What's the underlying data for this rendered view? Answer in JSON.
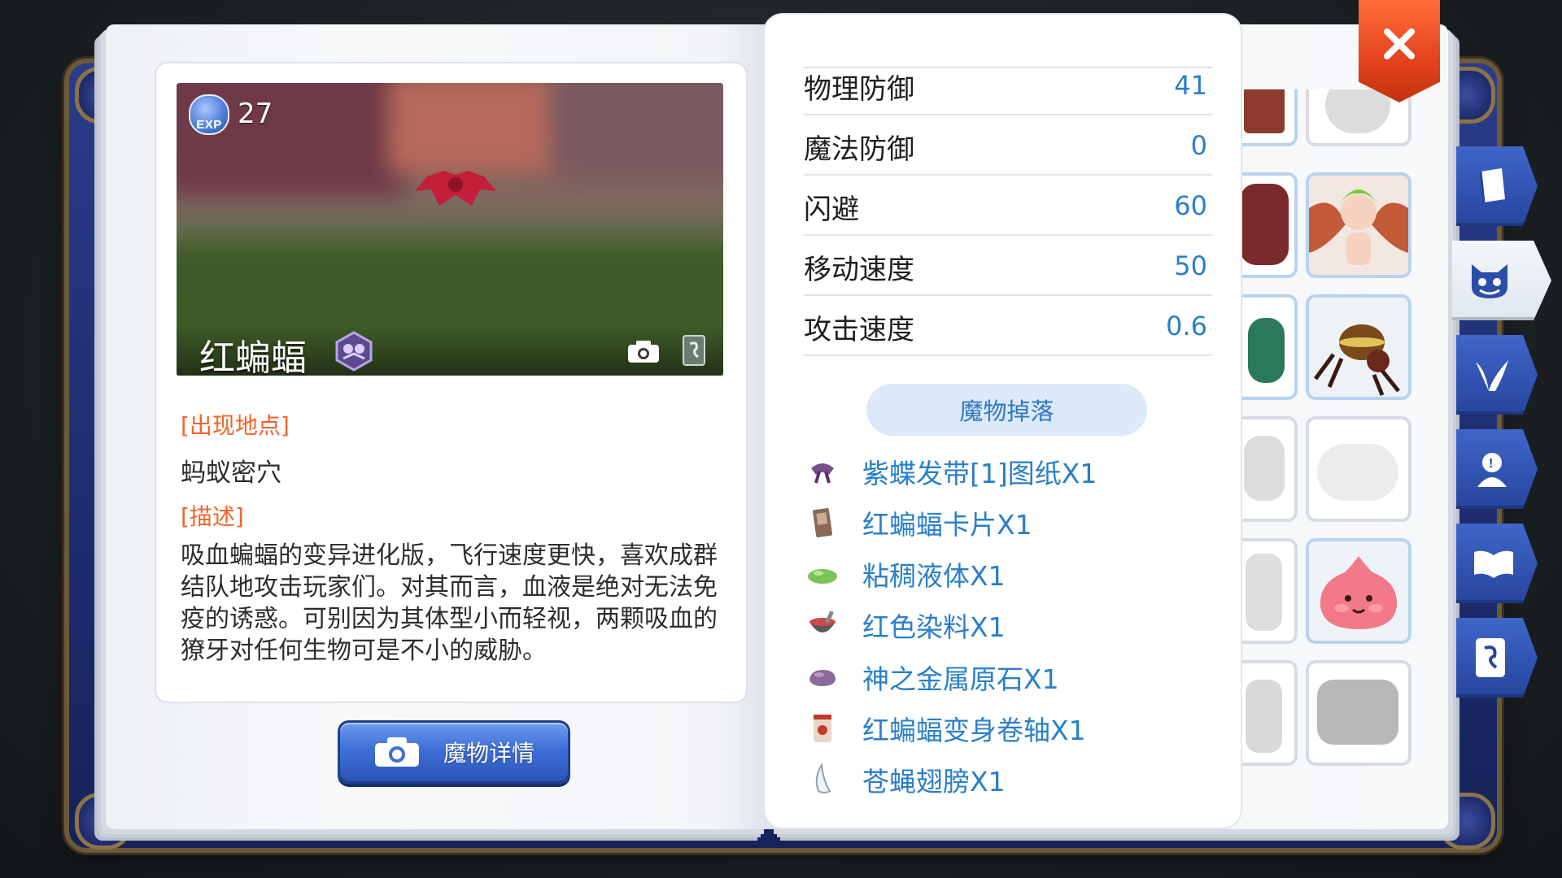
{
  "monster": {
    "exp_badge": "EXP",
    "exp_value": "27",
    "name": "红蝙蝠",
    "location_label": "[出现地点]",
    "location": "蚂蚁密穴",
    "description_label": "[描述]",
    "description": "吸血蝙蝠的变异进化版，飞行速度更快，喜欢成群结队地攻击玩家们。对其而言，血液是绝对无法免疫的诱惑。可别因为其体型小而轻视，两颗吸血的獠牙对任何生物可是不小的威胁。"
  },
  "detail_button": {
    "label": "魔物详情",
    "icon": "camera-icon"
  },
  "stats": [
    {
      "name": "物理防御",
      "value": "41"
    },
    {
      "name": "魔法防御",
      "value": "0"
    },
    {
      "name": "闪避",
      "value": "60"
    },
    {
      "name": "移动速度",
      "value": "50"
    },
    {
      "name": "攻击速度",
      "value": "0.6"
    }
  ],
  "drops": {
    "header": "魔物掉落",
    "items": [
      {
        "label": "紫蝶发带[1]图纸X1",
        "icon": "purple-headband-icon"
      },
      {
        "label": "红蝙蝠卡片X1",
        "icon": "card-icon"
      },
      {
        "label": "粘稠液体X1",
        "icon": "slime-icon"
      },
      {
        "label": "红色染料X1",
        "icon": "dye-bowl-icon"
      },
      {
        "label": "神之金属原石X1",
        "icon": "ore-icon"
      },
      {
        "label": "红蝙蝠变身卷轴X1",
        "icon": "scroll-icon"
      },
      {
        "label": "苍蝇翅膀X1",
        "icon": "wing-icon"
      }
    ]
  },
  "side_tabs": [
    {
      "name": "book-tab",
      "icon": "book-icon",
      "active": false
    },
    {
      "name": "monster-tab",
      "icon": "cat-face-icon",
      "active": true
    },
    {
      "name": "card-album-tab",
      "icon": "horns-icon",
      "active": false
    },
    {
      "name": "npc-tab",
      "icon": "bust-icon",
      "active": false
    },
    {
      "name": "open-book-tab",
      "icon": "open-book-icon",
      "active": false
    },
    {
      "name": "card-tab",
      "icon": "card-icon",
      "active": false
    }
  ],
  "colors": {
    "accent_blue": "#2a7fc9",
    "label_orange": "#f0652b",
    "close_red": "#e2421c",
    "book_blue": "#26459e"
  }
}
